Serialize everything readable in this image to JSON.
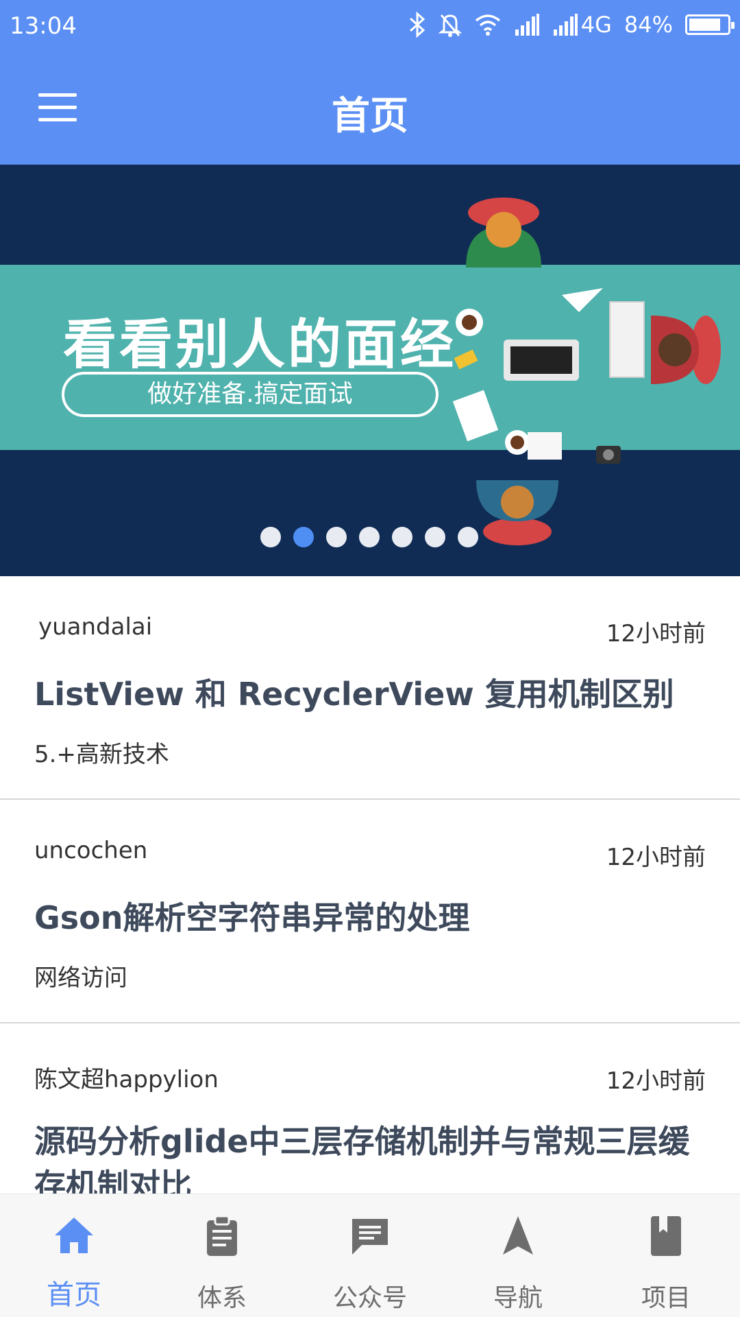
{
  "status_bar": {
    "time": "13:04",
    "network": "4G",
    "battery": "84%",
    "battery_level": 0.84,
    "icons": [
      "bluetooth-icon",
      "bell-off-icon",
      "wifi-icon",
      "signal-icon",
      "signal-icon"
    ]
  },
  "app_bar": {
    "title": "首页",
    "menu_icon": "hamburger-menu-icon"
  },
  "banner": {
    "headline": "看看别人的面经",
    "subtitle": "做好准备.搞定面试",
    "page_count": 7,
    "active_page": 2,
    "colors": {
      "background": "#102c55",
      "band": "#4fb2ad",
      "dot_active": "#4f8ef2"
    }
  },
  "articles": [
    {
      "author": "yuandalai",
      "time": "12小时前",
      "title": "ListView 和 RecyclerView 复用机制区别",
      "tag": "5.+高新技术"
    },
    {
      "author": "uncochen",
      "time": "12小时前",
      "title": "Gson解析空字符串异常的处理",
      "tag": "网络访问"
    },
    {
      "author": "陈文超happylion",
      "time": "12小时前",
      "title": "源码分析glide中三层存储机制并与常规三层缓存机制对比",
      "tag": ""
    }
  ],
  "bottom_nav": {
    "items": [
      {
        "label": "首页",
        "icon": "home-icon",
        "active": true
      },
      {
        "label": "体系",
        "icon": "clipboard-icon",
        "active": false
      },
      {
        "label": "公众号",
        "icon": "chat-icon",
        "active": false
      },
      {
        "label": "导航",
        "icon": "navigation-arrow-icon",
        "active": false
      },
      {
        "label": "项目",
        "icon": "bookmark-book-icon",
        "active": false
      }
    ],
    "colors": {
      "active": "#5b8ff4",
      "inactive": "#6d6d6d"
    }
  },
  "theme": {
    "primary": "#5b8ff4",
    "title_text": "#3e4a5c"
  }
}
